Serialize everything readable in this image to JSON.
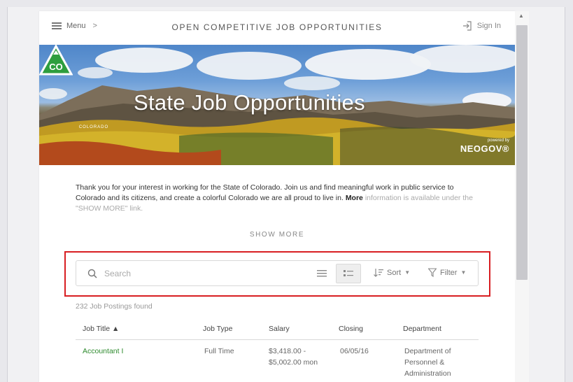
{
  "header": {
    "menu_label": "Menu",
    "menu_chevron": ">",
    "title": "OPEN COMPETITIVE JOB OPPORTUNITIES",
    "signin_label": "Sign In"
  },
  "banner": {
    "logo_text": "CO",
    "logo_caption": "COLORADO",
    "title": "State Job Opportunities",
    "powered_by": "powered by",
    "vendor": "NEOGOV®"
  },
  "intro": {
    "text": "Thank you for your interest in working for the State of Colorado. Join us and find meaningful work in public service to Colorado and its citizens, and create a colorful Colorado we are all proud to live in.",
    "more_label": "More",
    "fade_text": "information is available under the \"SHOW MORE\" link.",
    "show_more_label": "SHOW MORE"
  },
  "search": {
    "placeholder": "Search",
    "sort_label": "Sort",
    "filter_label": "Filter"
  },
  "results": {
    "count_text": "232 Job Postings found",
    "columns": [
      "Job Title ▲",
      "Job Type",
      "Salary",
      "Closing",
      "Department"
    ],
    "rows": [
      {
        "title": "Accountant I",
        "type": "Full Time",
        "salary_line1": "$3,418.00 -",
        "salary_line2": "$5,002.00 mon",
        "closing": "06/05/16",
        "dept_line1": "Department of",
        "dept_line2": "Personnel &",
        "dept_line3": "Administration"
      }
    ]
  },
  "colors": {
    "highlight": "#d81e22",
    "job_link": "#2d8a2d",
    "logo_green": "#2e9e3e"
  }
}
